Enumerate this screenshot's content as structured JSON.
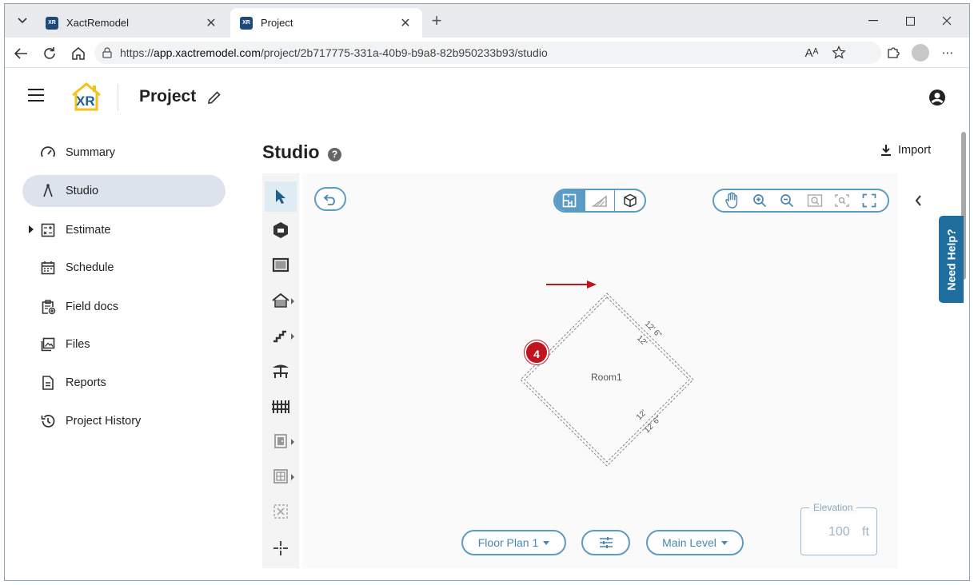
{
  "browser": {
    "tabs": [
      {
        "title": "XactRemodel",
        "active": false
      },
      {
        "title": "Project",
        "active": true
      }
    ],
    "url_prefix": "https://",
    "url_domain": "app.xactremodel.com",
    "url_path": "/project/2b717775-331a-40b9-b9a8-82b950233b93/studio",
    "read_aloud_label": "Aᴬ",
    "favicon_text": "XR"
  },
  "app": {
    "logo_text": "XR",
    "project_title": "Project"
  },
  "sidebar": {
    "items": [
      {
        "label": "Summary",
        "icon": "speedometer-icon",
        "active": false
      },
      {
        "label": "Studio",
        "icon": "compass-icon",
        "active": true
      },
      {
        "label": "Estimate",
        "icon": "calculator-icon",
        "active": false,
        "expandable": true
      },
      {
        "label": "Schedule",
        "icon": "calendar-icon",
        "active": false
      },
      {
        "label": "Field docs",
        "icon": "clipboard-add-icon",
        "active": false
      },
      {
        "label": "Files",
        "icon": "images-icon",
        "active": false
      },
      {
        "label": "Reports",
        "icon": "document-icon",
        "active": false
      },
      {
        "label": "Project History",
        "icon": "history-icon",
        "active": false
      }
    ]
  },
  "studio": {
    "title": "Studio",
    "help_label": "?",
    "import_label": "Import",
    "room": {
      "name": "Room1",
      "dims": [
        "12' 6\"",
        "12'",
        "12'",
        "12' 6\""
      ]
    },
    "floor_plan_label": "Floor Plan 1",
    "level_label": "Main Level",
    "elevation_label": "Elevation",
    "elevation_value": "100",
    "elevation_unit": "ft",
    "callout_number": "4"
  },
  "need_help_label": "Need Help?",
  "colors": {
    "accent": "#5b9bc4",
    "callout": "#c0141e",
    "need_help": "#1f6e9e",
    "logo_yellow": "#f5c21b",
    "logo_blue": "#1e5fa0"
  }
}
